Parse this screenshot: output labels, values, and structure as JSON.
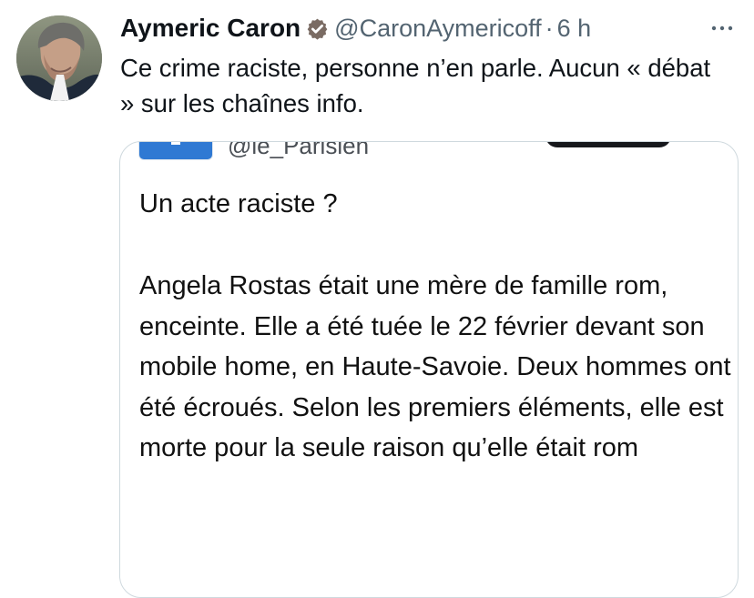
{
  "author": {
    "name": "Aymeric Caron",
    "handle": "@CaronAymericoff",
    "separator": "·",
    "time": "6 h",
    "avatar_icon": "profile-photo"
  },
  "tweet": {
    "text": "Ce crime raciste, personne n’en parle. Aucun « débat » sur les chaînes info."
  },
  "quoted_post": {
    "handle": "@le_Parisien",
    "title": "Un acte raciste ?",
    "body": "Angela Rostas était une mère de famille rom, enceinte. Elle a été tuée le 22 février devant son mobile home, en Haute-Savoie. Deux hommes ont été écroués. Selon les premiers éléments, elle est morte pour la seule raison qu’elle était rom"
  },
  "colors": {
    "text_primary": "#0f1419",
    "text_secondary": "#536471",
    "verified_badge": "#7a6b63",
    "card_border": "#cfd9de",
    "logo_blue": "#2f79d3"
  },
  "icons": {
    "verified": "verified-badge-icon",
    "more": "more-options-icon",
    "logo": "le-parisien-logo-icon"
  }
}
